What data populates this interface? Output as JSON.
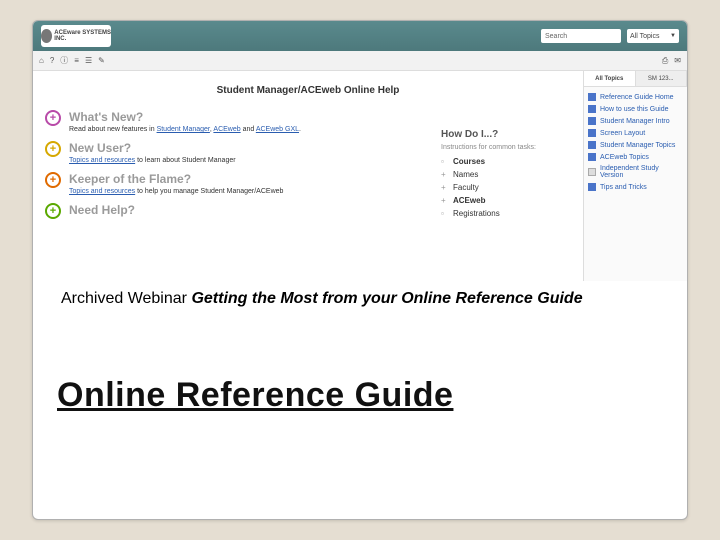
{
  "header": {
    "logo_text": "ACEware SYSTEMS INC.",
    "search_placeholder": "Search",
    "topics_selector": "All Topics"
  },
  "toolbar": {
    "icons": [
      "home-icon",
      "back-icon",
      "help-icon",
      "list-icon",
      "menu-icon",
      "edit-icon"
    ],
    "right_icons": [
      "print-icon",
      "mail-icon"
    ]
  },
  "help_title": "Student Manager/ACEweb Online Help",
  "sections": [
    {
      "icon_class": "plus-purple",
      "title": "What's New?",
      "desc_prefix": "Read about new features in ",
      "links": [
        "Student Manager",
        "ACEweb",
        "ACEweb GXL"
      ],
      "desc_suffix": "."
    },
    {
      "icon_class": "plus-yellow",
      "title": "New User?",
      "desc_prefix": "",
      "links": [
        "Topics and resources"
      ],
      "desc_suffix": " to learn about Student Manager"
    },
    {
      "icon_class": "plus-orange",
      "title": "Keeper of the Flame?",
      "desc_prefix": "",
      "links": [
        "Topics and resources"
      ],
      "desc_suffix": " to help you manage Student Manager/ACEweb"
    },
    {
      "icon_class": "plus-green",
      "title": "Need Help?",
      "desc_prefix": "",
      "links": [],
      "desc_suffix": ""
    }
  ],
  "howdo": {
    "title": "How Do I...?",
    "subtitle": "Instructions for common tasks:",
    "items": [
      "Courses",
      "Names",
      "Faculty",
      "ACEweb",
      "Registrations"
    ]
  },
  "sidebar": {
    "tabs": [
      "All Topics",
      "SM 123..."
    ],
    "items": [
      {
        "type": "book",
        "label": "Reference Guide Home"
      },
      {
        "type": "book",
        "label": "How to use this Guide"
      },
      {
        "type": "book",
        "label": "Student Manager Intro"
      },
      {
        "type": "book",
        "label": "Screen Layout"
      },
      {
        "type": "book",
        "label": "Student Manager Topics"
      },
      {
        "type": "book",
        "label": "ACEweb Topics"
      },
      {
        "type": "doc",
        "label": "Independent Study Version"
      },
      {
        "type": "book",
        "label": "Tips and Tricks"
      }
    ]
  },
  "caption": {
    "prefix": "Archived Webinar  ",
    "bold_italic": "Getting the Most from your Online Reference Guide"
  },
  "big_link": "Online Reference Guide"
}
